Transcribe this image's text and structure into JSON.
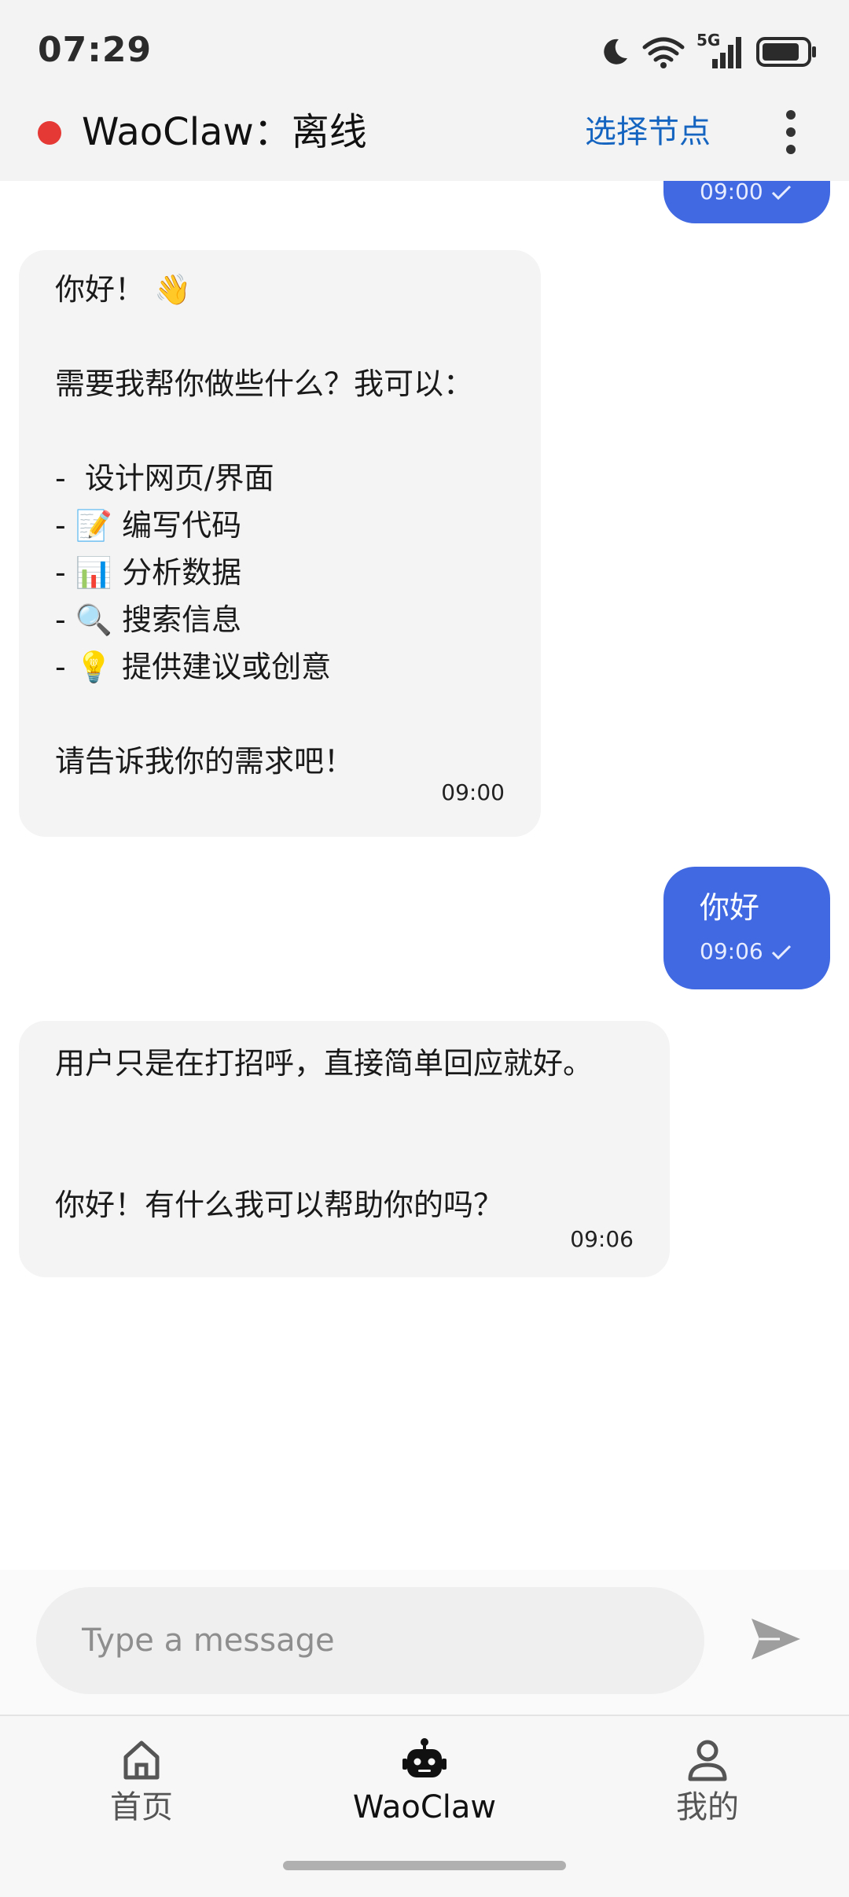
{
  "status_bar": {
    "time": "07:29",
    "network_label": "5G",
    "icons": [
      "moon-icon",
      "wifi-icon",
      "cellular-signal-icon",
      "battery-icon"
    ]
  },
  "header": {
    "status_color": "#e53935",
    "title": "WaoClaw：离线",
    "select_node_label": "选择节点",
    "more_icon": "more-vertical-icon"
  },
  "messages": [
    {
      "role": "user",
      "text": "",
      "time": "09:00",
      "read_icon": "check-icon"
    },
    {
      "role": "bot",
      "text": "你好！ 👋\n\n需要我帮你做些什么？我可以：\n\n-  设计网页/界面\n- 📝 编写代码\n- 📊 分析数据\n- 🔍 搜索信息\n- 💡 提供建议或创意\n\n请告诉我你的需求吧！",
      "time": "09:00"
    },
    {
      "role": "user",
      "text": "你好",
      "time": "09:06",
      "read_icon": "check-icon"
    },
    {
      "role": "bot",
      "text": "用户只是在打招呼，直接简单回应就好。\n\n\n你好！有什么我可以帮助你的吗？",
      "time": "09:06"
    }
  ],
  "input": {
    "value": "",
    "placeholder": "Type a message",
    "send_icon": "send-icon"
  },
  "bottom_nav": {
    "items": [
      {
        "label": "首页",
        "icon": "home-icon",
        "active": false
      },
      {
        "label": "WaoClaw",
        "icon": "robot-icon",
        "active": true
      },
      {
        "label": "我的",
        "icon": "user-icon",
        "active": false
      }
    ]
  },
  "colors": {
    "accent": "#4169e1",
    "link": "#1565c0",
    "offline": "#e53935"
  }
}
